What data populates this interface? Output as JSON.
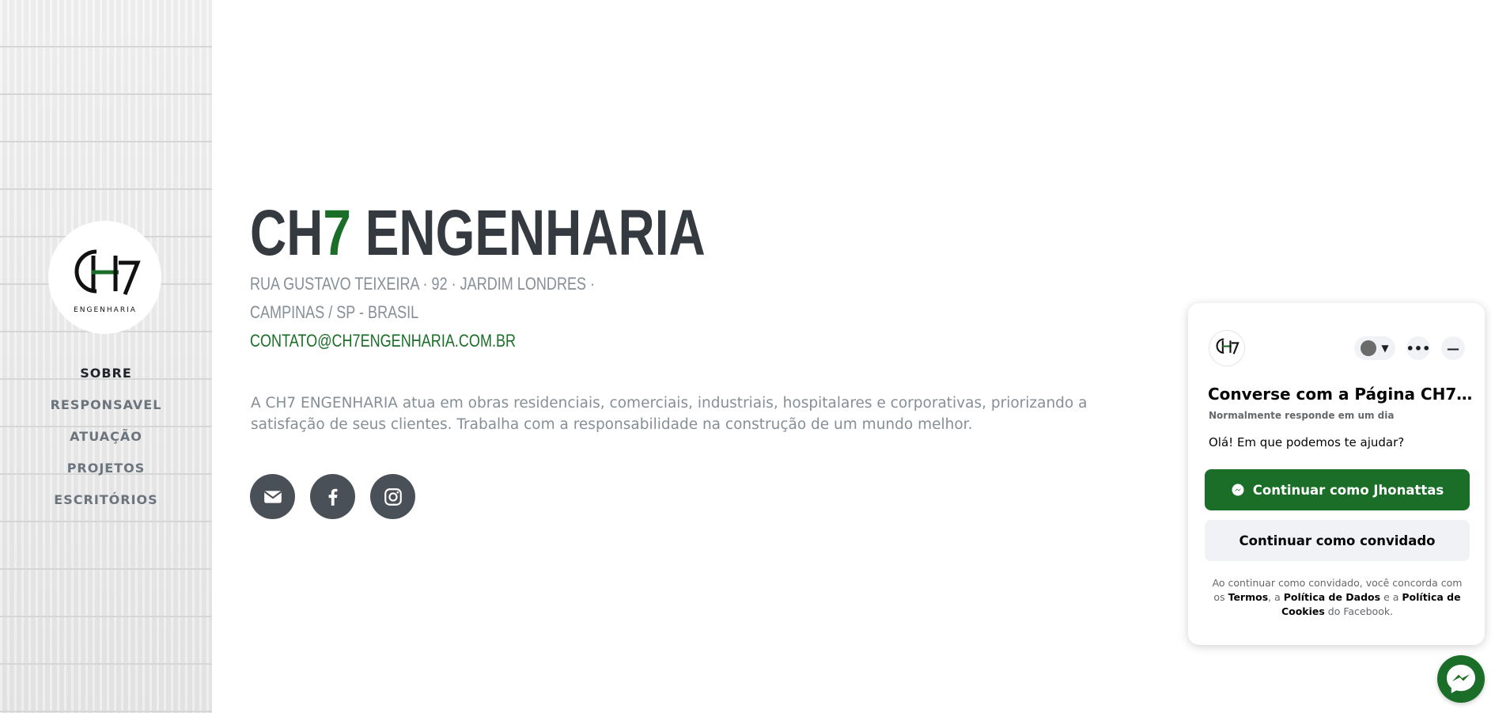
{
  "brand": {
    "logo_text": "CH7",
    "logo_subtitle": "ENGENHARIA",
    "accent_color": "#1b6e28",
    "dark_color": "#343a40"
  },
  "sidebar": {
    "items": [
      {
        "label": "SOBRE",
        "active": true
      },
      {
        "label": "RESPONSAVEL",
        "active": false
      },
      {
        "label": "ATUAÇÃO",
        "active": false
      },
      {
        "label": "PROJETOS",
        "active": false
      },
      {
        "label": "ESCRITÓRIOS",
        "active": false
      }
    ]
  },
  "main": {
    "title_part1": "CH",
    "title_accent": "7",
    "title_part2": " ENGENHARIA",
    "address_line1": "RUA GUSTAVO TEIXEIRA · 92 · JARDIM LONDRES ·",
    "address_line2": "CAMPINAS / SP - BRASIL",
    "email": "CONTATO@CH7ENGENHARIA.COM.BR",
    "description": "A CH7 ENGENHARIA atua em obras residenciais, comerciais, industriais, hospitalares e corporativas, priorizando a satisfação de seus clientes. Trabalha com a responsabilidade na construção de um mundo melhor.",
    "social": [
      {
        "icon": "envelope-icon"
      },
      {
        "icon": "facebook-icon"
      },
      {
        "icon": "instagram-icon"
      }
    ]
  },
  "chat": {
    "title": "Converse com a Página CH7 Eng...",
    "subtitle": "Normalmente responde em um dia",
    "greeting": "Olá! Em que podemos te ajudar?",
    "primary_button": "Continuar como Jhonattas",
    "secondary_button": "Continuar como convidado",
    "legal_prefix": "Ao continuar como convidado, você concorda com os",
    "legal_terms": "Termos",
    "legal_sep1": ", a",
    "legal_data_policy": "Política de Dados",
    "legal_sep2": "e a",
    "legal_cookies": "Política de Cookies",
    "legal_suffix": "do Facebook.",
    "more_icon": "more-icon",
    "minimize_icon": "minimize-icon"
  }
}
